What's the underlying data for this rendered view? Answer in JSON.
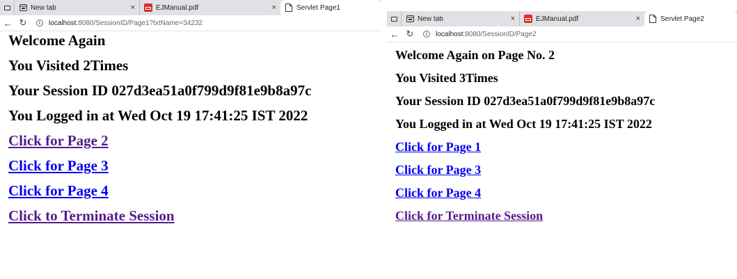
{
  "left": {
    "tabs": [
      {
        "label": "New tab",
        "icon": "newtab-icon",
        "active": false,
        "close": "×"
      },
      {
        "label": "EJManual.pdf",
        "icon": "pdf-icon",
        "active": false,
        "close": "×"
      },
      {
        "label": "Servlet Page1",
        "icon": "page-icon",
        "active": true
      }
    ],
    "address": {
      "host": "localhost",
      "path": ":8080/SessionID/Page1?txtName=34232"
    },
    "content": {
      "welcome": "Welcome Again",
      "visits": "You Visited 2Times",
      "session": "Your Session ID 027d3ea51a0f799d9f81e9b8a97c",
      "logged": "You Logged in at Wed Oct 19 17:41:25 IST 2022",
      "links": [
        {
          "label": "Click for Page 2",
          "visited": true
        },
        {
          "label": "Click for Page 3",
          "visited": false
        },
        {
          "label": "Click for Page 4",
          "visited": false
        },
        {
          "label": "Click to Terminate Session",
          "visited": true
        }
      ]
    }
  },
  "right": {
    "tabs": [
      {
        "label": "New tab",
        "icon": "newtab-icon",
        "active": false,
        "close": "×"
      },
      {
        "label": "EJManual.pdf",
        "icon": "pdf-icon",
        "active": false,
        "close": "×"
      },
      {
        "label": "Servlet Page2",
        "icon": "page-icon",
        "active": true
      }
    ],
    "address": {
      "host": "localhost",
      "path": ":8080/SessionID/Page2"
    },
    "content": {
      "welcome": "Welcome Again on Page No. 2",
      "visits": "You Visited 3Times",
      "session": "Your Session ID 027d3ea51a0f799d9f81e9b8a97c",
      "logged": "You Logged in at Wed Oct 19 17:41:25 IST 2022",
      "links": [
        {
          "label": "Click for Page 1",
          "visited": false
        },
        {
          "label": "Click for Page 3",
          "visited": false
        },
        {
          "label": "Click for Page 4",
          "visited": false
        },
        {
          "label": "Click for Terminate Session",
          "visited": true
        }
      ]
    }
  },
  "colors": {
    "link": "#0000ee",
    "visited_link": "#551a8b",
    "tabstrip": "#dfe1e5",
    "pdf_icon": "#d93025"
  }
}
